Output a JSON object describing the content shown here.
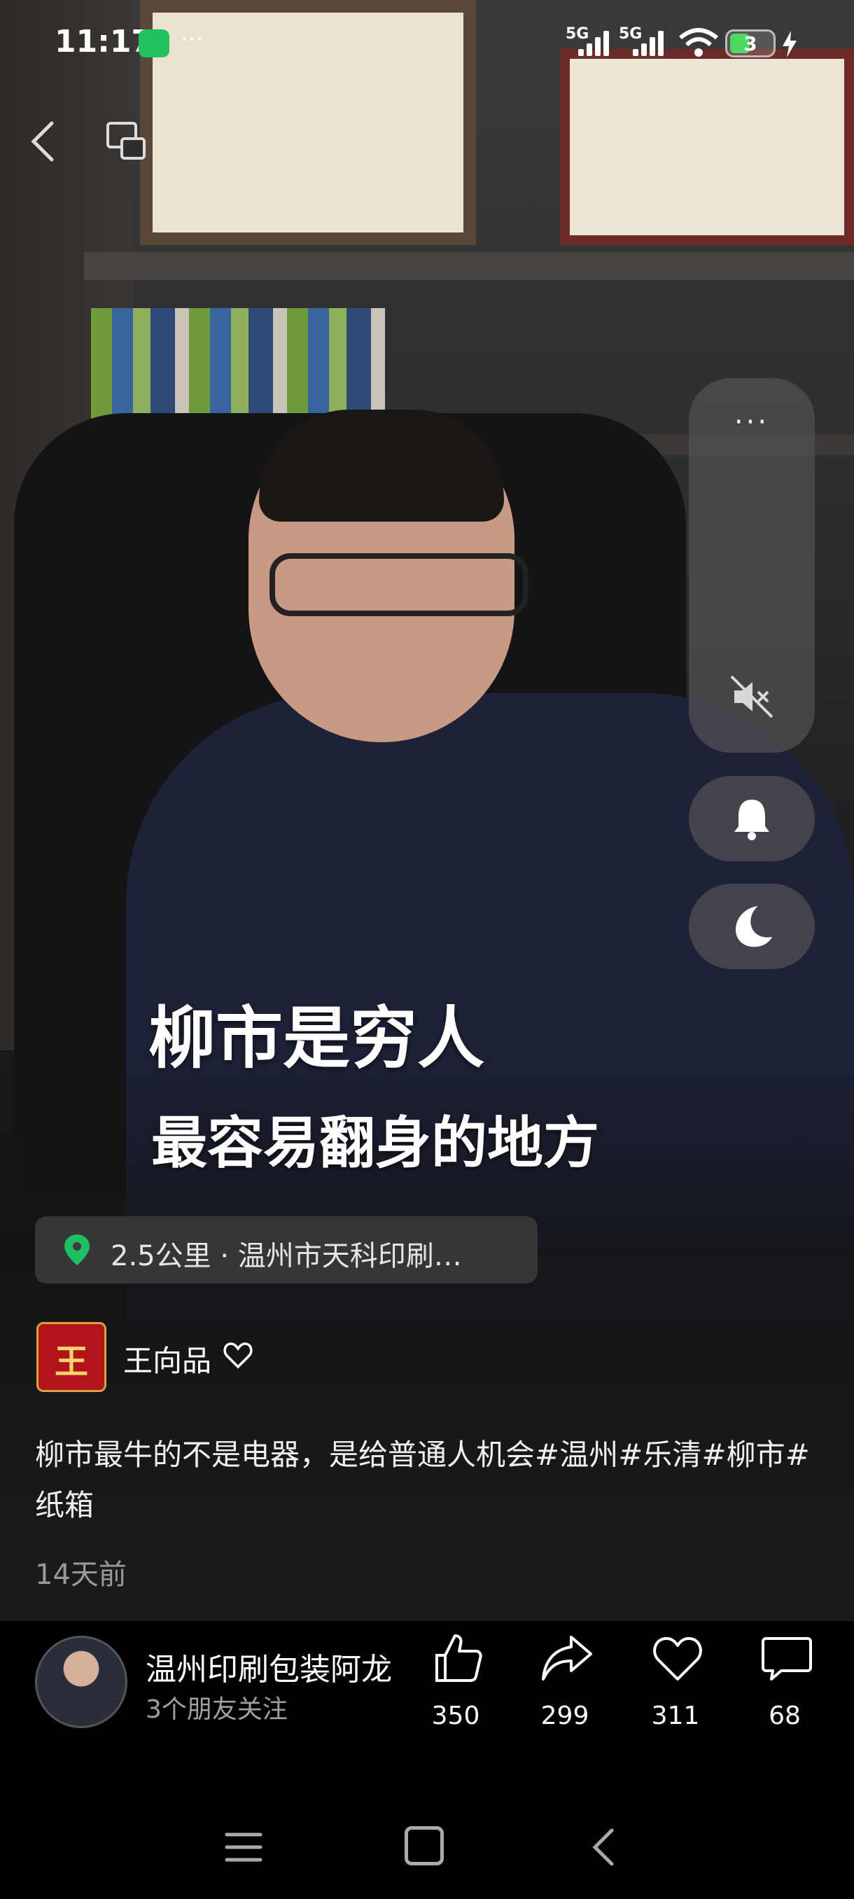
{
  "status_bar": {
    "time": "11:17",
    "more": "···",
    "signal1_label": "5G",
    "signal2_label": "5G",
    "battery": "3",
    "icons": [
      "wechat-icon",
      "wifi-icon",
      "battery-icon",
      "charging-icon"
    ]
  },
  "top_nav": {
    "icons": [
      "back-icon",
      "pip-icon"
    ]
  },
  "side_panel": {
    "more": "···",
    "icons": [
      "mute-icon",
      "bell-icon",
      "moon-icon"
    ]
  },
  "video": {
    "caption_line1": "柳市是穷人",
    "caption_line2": "最容易翻身的地方"
  },
  "location": {
    "text": "2.5公里 · 温州市天科印刷…",
    "icon": "location-pin-icon",
    "icon_color": "#1fbf63"
  },
  "author": {
    "avatar_glyph": "王",
    "name": "王向品"
  },
  "post": {
    "description": "柳市最牛的不是电器，是给普通人机会#温州#乐清#柳市#纸箱",
    "time_ago": "14天前"
  },
  "channel": {
    "name": "温州印刷包装阿龙",
    "followers": "3个朋友关注"
  },
  "actions": [
    {
      "name": "like",
      "icon": "thumbs-up-icon",
      "count": "350"
    },
    {
      "name": "share",
      "icon": "share-icon",
      "count": "299"
    },
    {
      "name": "favorite",
      "icon": "heart-icon",
      "count": "311"
    },
    {
      "name": "comment",
      "icon": "comment-icon",
      "count": "68"
    }
  ],
  "system_nav": {
    "icons": [
      "menu-icon",
      "home-icon",
      "back-icon"
    ]
  }
}
